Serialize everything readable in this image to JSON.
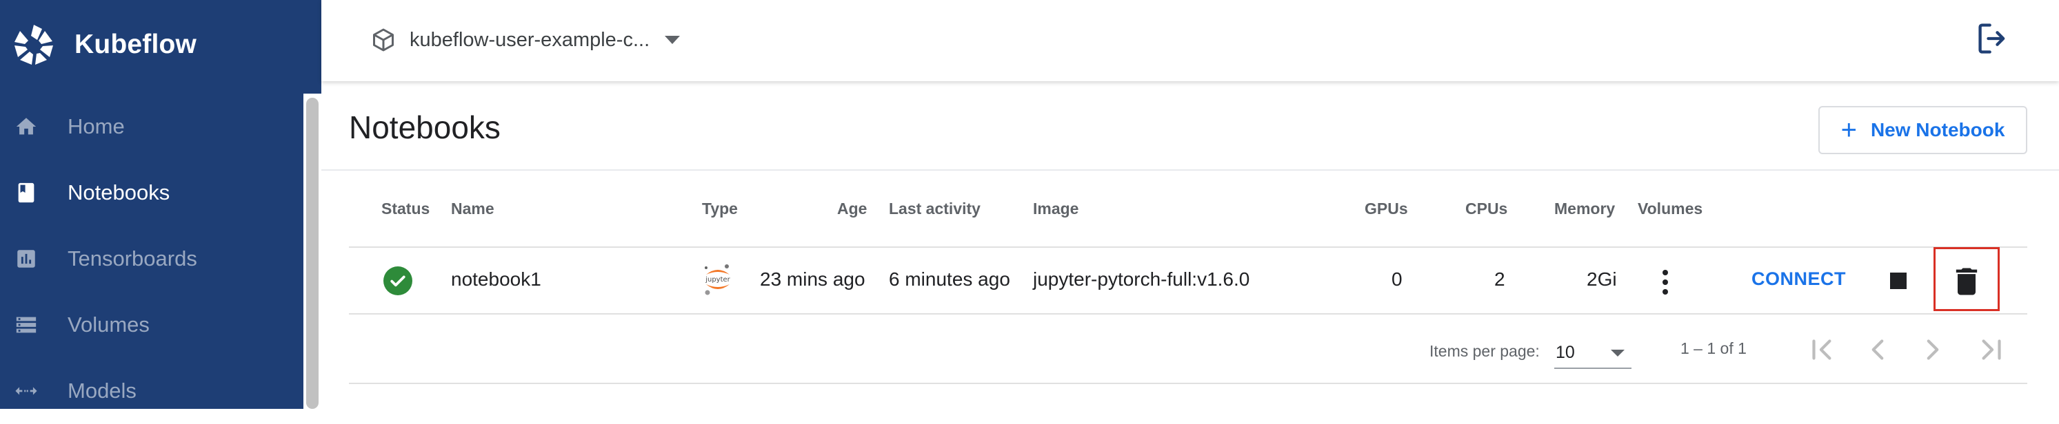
{
  "brand": {
    "name": "Kubeflow"
  },
  "sidebar": {
    "items": [
      {
        "label": "Home",
        "icon": "home-icon",
        "active": false
      },
      {
        "label": "Notebooks",
        "icon": "notebook-icon",
        "active": true
      },
      {
        "label": "Tensorboards",
        "icon": "chart-icon",
        "active": false
      },
      {
        "label": "Volumes",
        "icon": "storage-icon",
        "active": false
      },
      {
        "label": "Models",
        "icon": "code-arrows-icon",
        "active": false
      }
    ]
  },
  "header": {
    "namespace": "kubeflow-user-example-c...",
    "namespace_icon": "cube-icon",
    "logout_icon": "logout-icon"
  },
  "page": {
    "title": "Notebooks",
    "new_button_label": "New Notebook"
  },
  "table": {
    "columns": {
      "status": "Status",
      "name": "Name",
      "type": "Type",
      "age": "Age",
      "last_activity": "Last activity",
      "image": "Image",
      "gpus": "GPUs",
      "cpus": "CPUs",
      "memory": "Memory",
      "volumes": "Volumes"
    },
    "rows": [
      {
        "status": "ready",
        "name": "notebook1",
        "type_icon": "jupyter-icon",
        "type_label": "jupyter",
        "age": "23 mins ago",
        "last_activity": "6 minutes ago",
        "image": "jupyter-pytorch-full:v1.6.0",
        "gpus": "0",
        "cpus": "2",
        "memory": "2Gi",
        "connect_label": "CONNECT"
      }
    ]
  },
  "pagination": {
    "items_per_page_label": "Items per page:",
    "items_per_page": "10",
    "range": "1 – 1 of 1"
  },
  "colors": {
    "sidebar_bg": "#1e3e75",
    "accent": "#1a73e8",
    "status_ok": "#2e8b3a",
    "highlight": "#d93025"
  }
}
